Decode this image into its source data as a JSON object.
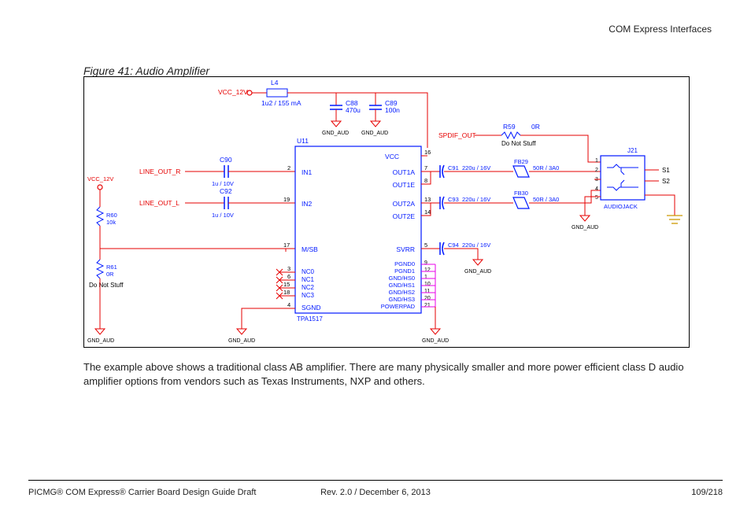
{
  "header": {
    "section": "COM Express Interfaces"
  },
  "figure": {
    "caption": "Figure 41:    Audio Amplifier"
  },
  "schematic": {
    "power": {
      "vcc12_top": "VCC_12V",
      "vcc12_left": "VCC_12V"
    },
    "inductor": {
      "ref": "L4",
      "value": "1u2 / 155 mA"
    },
    "caps_top": {
      "c88_ref": "C88",
      "c88_val": "470u",
      "c89_ref": "C89",
      "c89_val": "100n",
      "gnd_a": "GND_AUD",
      "gnd_b": "GND_AUD"
    },
    "spdif": {
      "label": "SPDIF_OUT"
    },
    "r59": {
      "ref": "R59",
      "val": "0R",
      "note": "Do Not Stuff"
    },
    "inputs": {
      "line_r": "LINE_OUT_R",
      "line_l": "LINE_OUT_L",
      "c90_ref": "C90",
      "c90_val": "1u / 10V",
      "c92_ref": "C92",
      "c92_val": "1u / 10V"
    },
    "chip": {
      "ref": "U11",
      "part": "TPA1517",
      "pins_left": {
        "in1": {
          "n": "2",
          "name": "IN1"
        },
        "in2": {
          "n": "19",
          "name": "IN2"
        },
        "msb": {
          "n": "17",
          "name": "M/SB"
        },
        "nc0": {
          "n": "3",
          "name": "NC0"
        },
        "nc1": {
          "n": "6",
          "name": "NC1"
        },
        "nc2": {
          "n": "15",
          "name": "NC2"
        },
        "nc3": {
          "n": "18",
          "name": "NC3"
        },
        "sgnd": {
          "n": "4",
          "name": "SGND"
        }
      },
      "pins_right": {
        "vcc": {
          "n": "16",
          "name": "VCC"
        },
        "out1a": {
          "n": "7",
          "name": "OUT1A"
        },
        "out1e": {
          "n": "8",
          "name": "OUT1E"
        },
        "out2a": {
          "n": "13",
          "name": "OUT2A"
        },
        "out2e": {
          "n": "14",
          "name": "OUT2E"
        },
        "svrr": {
          "n": "5",
          "name": "SVRR"
        },
        "pg0": {
          "n": "9",
          "name": "PGND0"
        },
        "pg1": {
          "n": "12",
          "name": "PGND1"
        },
        "hs0": {
          "n": "1",
          "name": "GND/HS0"
        },
        "hs1": {
          "n": "10",
          "name": "GND/HS1"
        },
        "hs2": {
          "n": "11",
          "name": "GND/HS2"
        },
        "hs3": {
          "n": "20",
          "name": "GND/HS3"
        },
        "pp": {
          "n": "21",
          "name": "POWERPAD"
        }
      }
    },
    "outputs": {
      "c91_ref": "C91",
      "c91_val": "220u / 16V",
      "c93_ref": "C93",
      "c93_val": "220u / 16V",
      "c94_ref": "C94",
      "c94_val": "220u / 16V",
      "fb29_ref": "FB29",
      "fb29_val": "50R / 3A0",
      "fb30_ref": "FB30",
      "fb30_val": "50R / 3A0",
      "gnd_c94": "GND_AUD"
    },
    "jack": {
      "ref": "J21",
      "type": "AUDIOJACK",
      "pin1": "1",
      "pin2": "2",
      "pin3": "3",
      "pin4": "4",
      "pin5": "5",
      "s1": "S1",
      "s2": "S2",
      "gnd": "GND_AUD"
    },
    "left_divider": {
      "r60_ref": "R60",
      "r60_val": "10k",
      "r61_ref": "R61",
      "r61_val": "0R",
      "r61_note": "Do Not Stuff",
      "gnd": "GND_AUD"
    },
    "gnd_mid": "GND_AUD",
    "gnd_right_chip": "GND_AUD"
  },
  "description": {
    "text": "The example above shows a traditional class AB amplifier.  There are many physically smaller and more power efficient class D audio amplifier options from vendors such as Texas Instruments, NXP and others."
  },
  "footer": {
    "left": "PICMG® COM Express® Carrier Board Design Guide Draft",
    "center": "Rev. 2.0 / December 6, 2013",
    "right": "109/218"
  }
}
